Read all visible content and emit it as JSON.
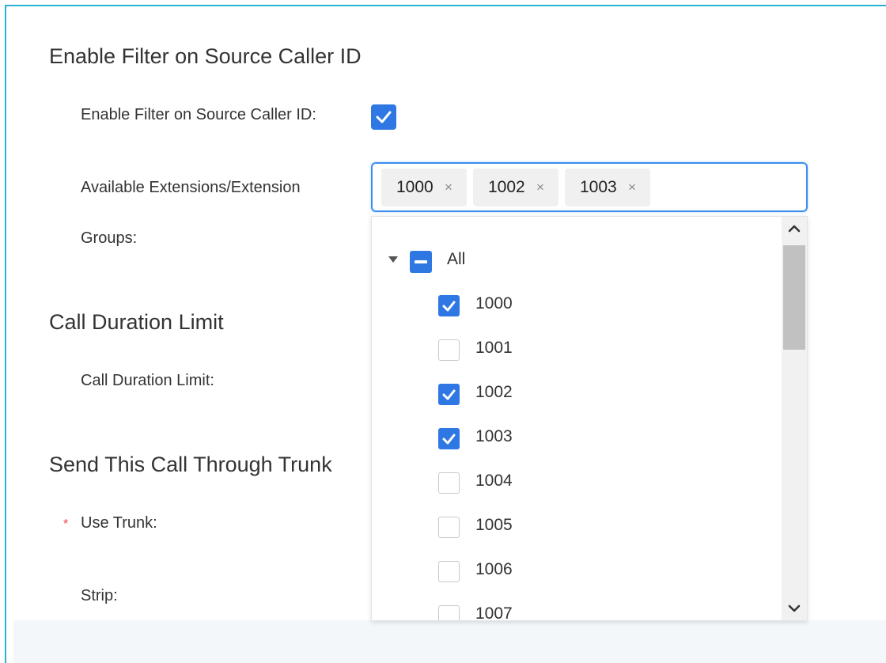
{
  "sections": {
    "filter_title": "Enable Filter on Source Caller ID",
    "duration_title": "Call Duration Limit",
    "trunk_title": "Send This Call Through Trunk"
  },
  "fields": {
    "enable_filter_label": "Enable Filter on Source Caller ID:",
    "enable_filter_checked": true,
    "available_ext_label": "Available Extensions/Extension",
    "groups_label": "Groups:",
    "duration_limit_label": "Call Duration Limit:",
    "use_trunk_required": "*",
    "use_trunk_label": "Use Trunk:",
    "strip_label": "Strip:"
  },
  "selected_tags": [
    {
      "label": "1000",
      "remove": "×"
    },
    {
      "label": "1002",
      "remove": "×"
    },
    {
      "label": "1003",
      "remove": "×"
    }
  ],
  "dropdown": {
    "all_label": "All",
    "all_state": "indeterminate",
    "options": [
      {
        "label": "1000",
        "checked": true
      },
      {
        "label": "1001",
        "checked": false
      },
      {
        "label": "1002",
        "checked": true
      },
      {
        "label": "1003",
        "checked": true
      },
      {
        "label": "1004",
        "checked": false
      },
      {
        "label": "1005",
        "checked": false
      },
      {
        "label": "1006",
        "checked": false
      },
      {
        "label": "1007",
        "checked": false
      }
    ]
  },
  "colors": {
    "accent": "#2f78e4",
    "frame_border": "#29b2d1",
    "required": "#e64545"
  },
  "icons": {
    "tag_remove": "close-icon",
    "tree_toggle": "caret-down-icon",
    "scroll_up": "chevron-up-icon",
    "scroll_down": "chevron-down-icon"
  }
}
